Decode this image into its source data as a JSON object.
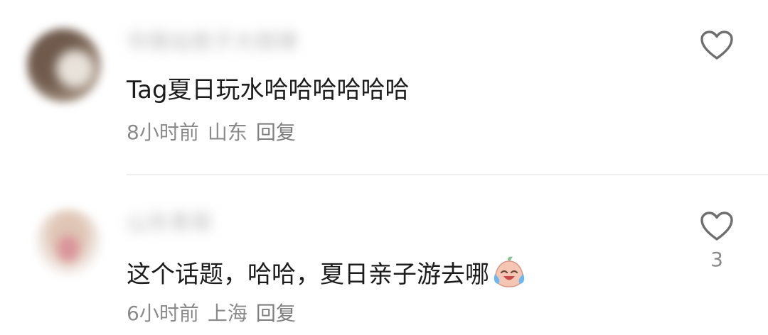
{
  "comments": [
    {
      "username": "华南站夜子大规律",
      "text": "Tag夏日玩水哈哈哈哈哈哈",
      "time": "8小时前",
      "location": "山东",
      "reply": "回复",
      "likes": ""
    },
    {
      "username": "山东青哥",
      "text": "这个话题，哈哈，夏日亲子游去哪",
      "emoji": "laughing-crying-face",
      "time": "6小时前",
      "location": "上海",
      "reply": "回复",
      "likes": "3"
    }
  ],
  "colors": {
    "text": "#1c1c1c",
    "meta": "#8a8a8a",
    "divider": "#efefef",
    "heart_outline": "#6e6e6e"
  }
}
